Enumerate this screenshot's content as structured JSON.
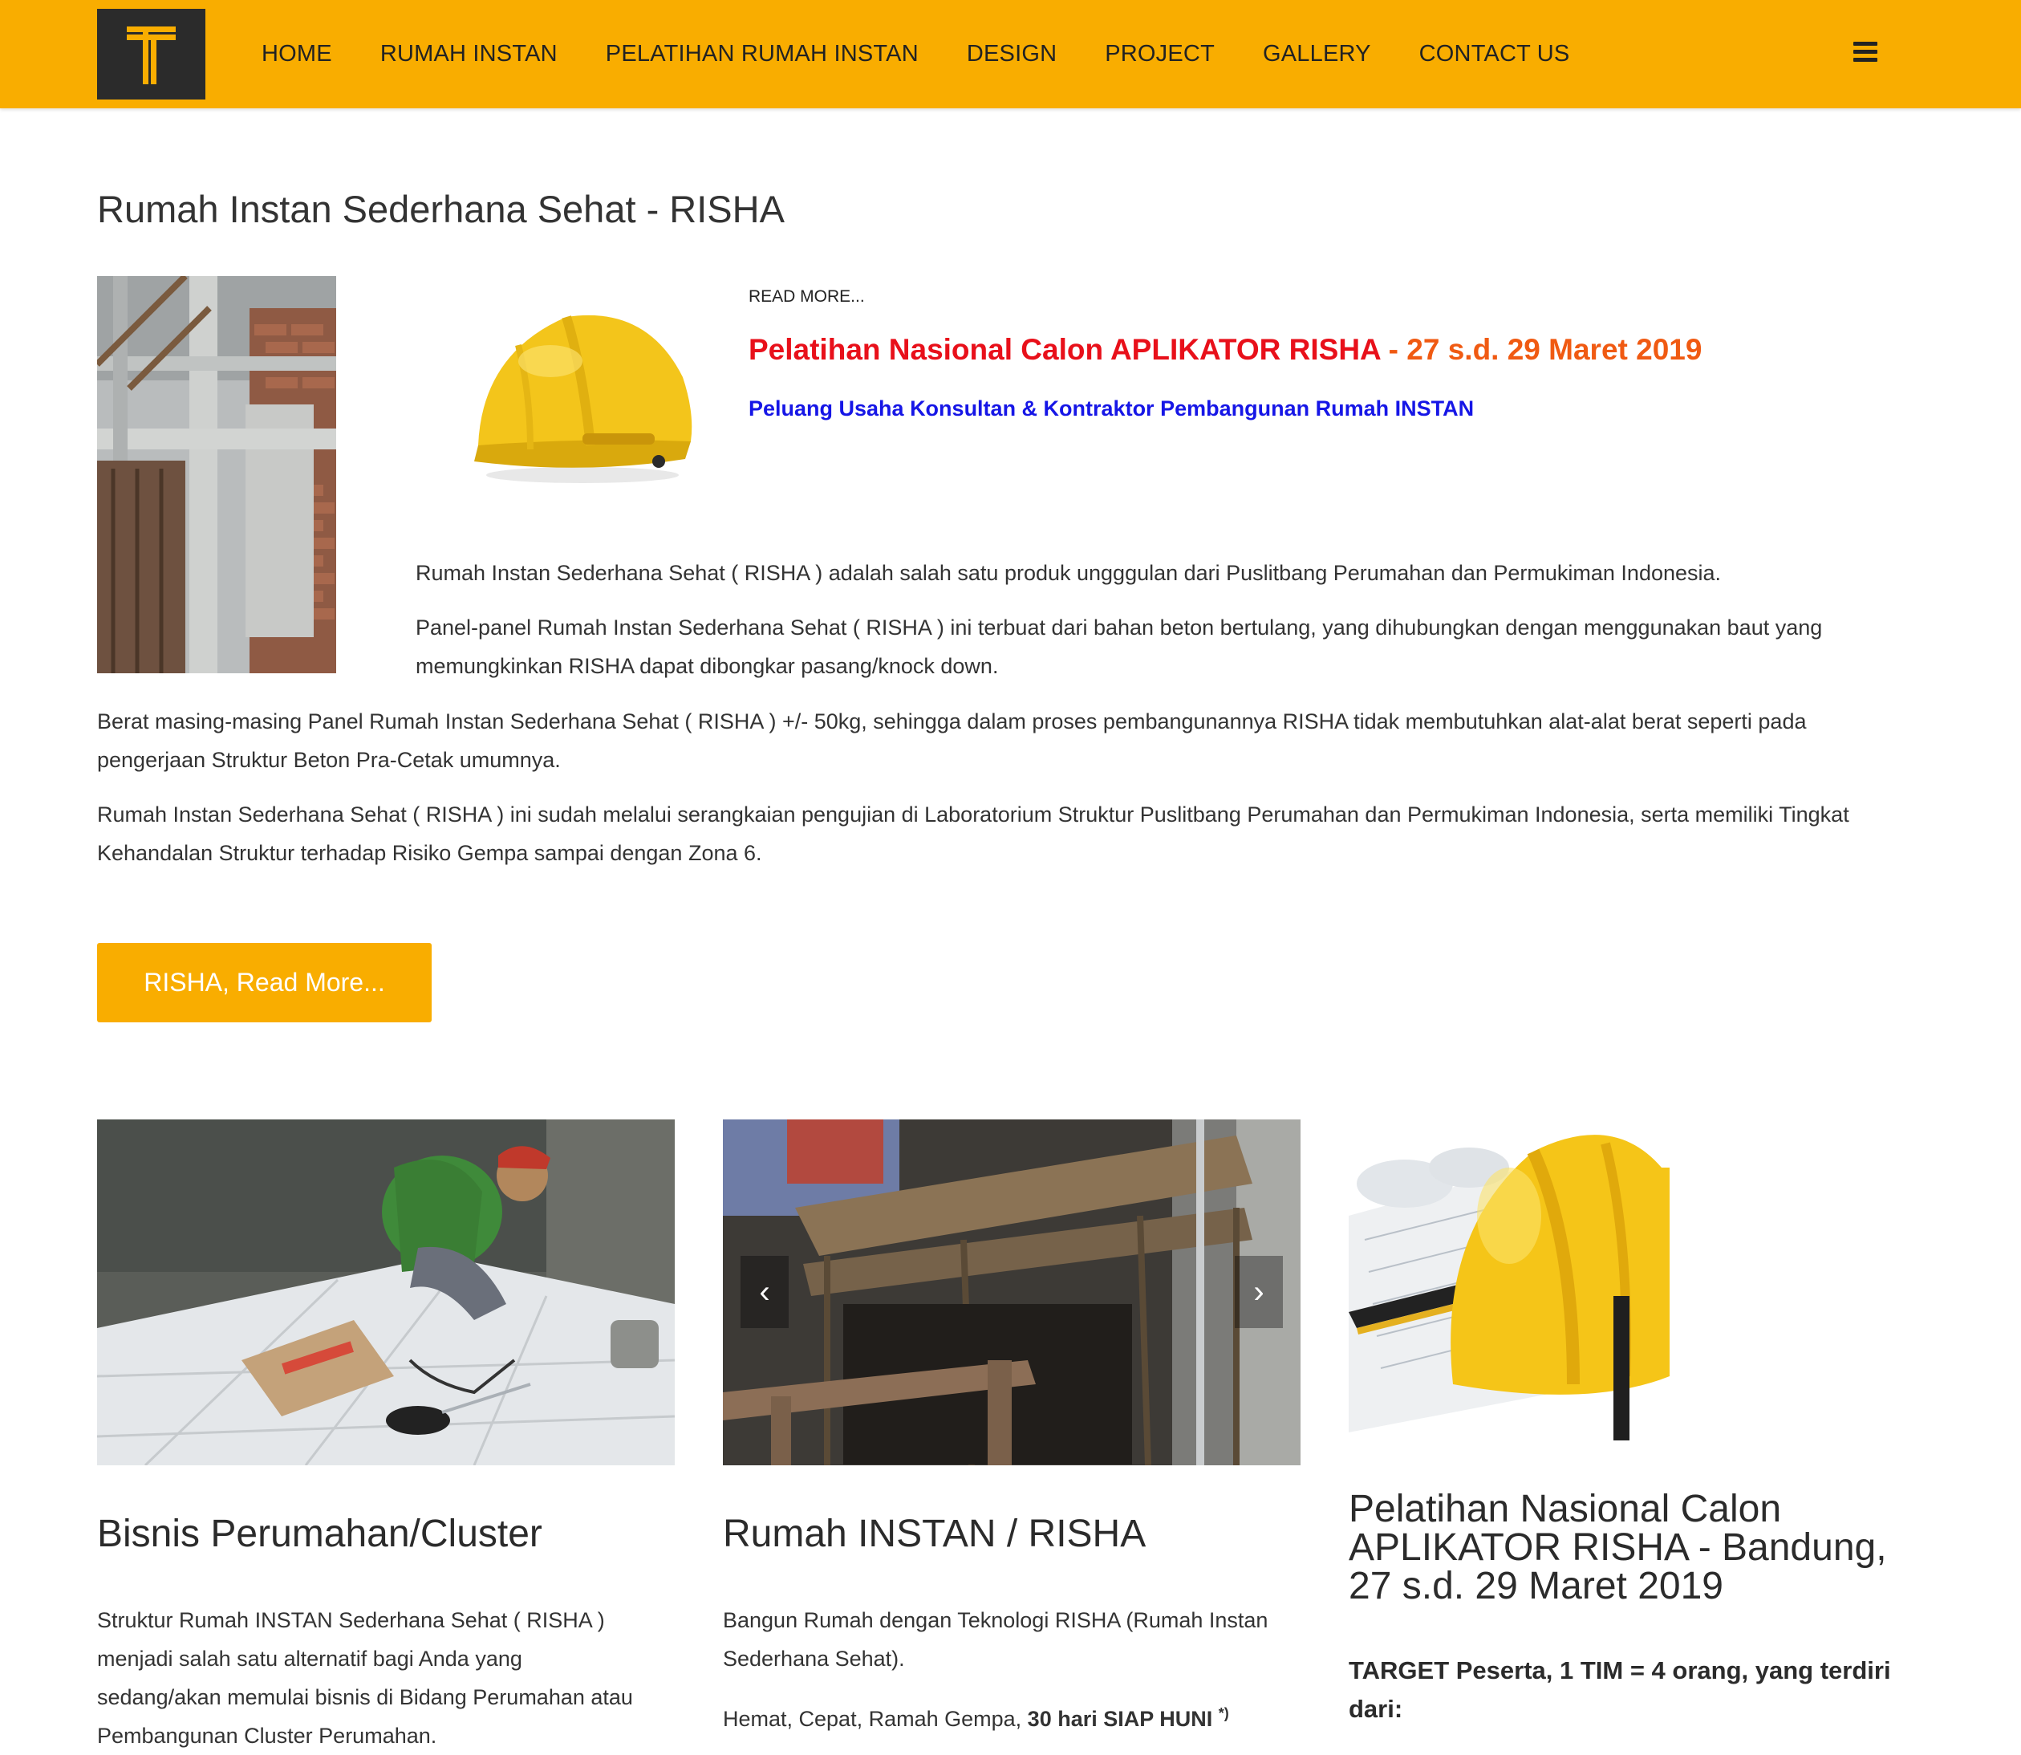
{
  "header": {
    "logo_letter": "T",
    "nav": [
      "HOME",
      "RUMAH INSTAN",
      "PELATIHAN RUMAH INSTAN",
      "DESIGN",
      "PROJECT",
      "GALLERY",
      "CONTACT US"
    ],
    "brand_color": "#f9ad00"
  },
  "intro": {
    "title": "Rumah Instan Sederhana Sehat - RISHA",
    "read_more_small": "READ MORE...",
    "promo_title_main": "Pelatihan Nasional Calon APLIKATOR RISHA",
    "promo_title_date": " - 27 s.d. 29 Maret 2019",
    "promo_subtitle": "Peluang Usaha Konsultan & Kontraktor Pembangunan Rumah INSTAN",
    "p1": "Rumah Instan Sederhana Sehat ( RISHA ) adalah salah satu produk ungggulan dari Puslitbang Perumahan dan Permukiman Indonesia.",
    "p2_line1": "Panel-panel Rumah Instan Sederhana Sehat ( RISHA ) ini terbuat dari bahan beton bertulang, yang dihubungkan dengan menggunakan baut yang",
    "p2_line2": "memungkinkan RISHA dapat dibongkar pasang/knock down.",
    "p3_line1": "Berat masing-masing Panel Rumah Instan Sederhana Sehat ( RISHA ) +/- 50kg, sehingga dalam proses pembangunannya RISHA tidak membutuhkan alat-alat berat seperti pada",
    "p3_line2": "pengerjaan Struktur Beton Pra-Cetak umumnya.",
    "p4_line1": "Rumah Instan Sederhana Sehat ( RISHA ) ini sudah melalui serangkaian pengujian di Laboratorium Struktur Puslitbang Perumahan dan Permukiman Indonesia, serta memiliki Tingkat",
    "p4_line2": "Kehandalan Struktur terhadap Risiko Gempa sampai dengan Zona 6.",
    "button": "RISHA, Read More..."
  },
  "columns": [
    {
      "title": "Bisnis Perumahan/Cluster",
      "lines": [
        "Struktur Rumah INSTAN Sederhana Sehat ( RISHA )",
        "menjadi salah satu alternatif bagi Anda yang",
        "sedang/akan memulai bisnis di Bidang Perumahan atau",
        "Pembangunan Cluster Perumahan."
      ]
    },
    {
      "title": "Rumah INSTAN / RISHA",
      "line1": "Bangun Rumah dengan Teknologi RISHA (Rumah Instan",
      "line2": "Sederhana Sehat).",
      "line3_a": "Hemat, Cepat, Ramah Gempa, ",
      "line3_b": "30 hari SIAP HUNI",
      "line3_sup": "*)",
      "prev": "‹",
      "next": "›"
    },
    {
      "title_lines": [
        "Pelatihan Nasional Calon",
        "APLIKATOR RISHA - Bandung,",
        "27 s.d. 29 Maret 2019"
      ],
      "target_lines": [
        "TARGET Peserta, 1 TIM = 4 orang, yang terdiri",
        "dari:"
      ]
    }
  ]
}
